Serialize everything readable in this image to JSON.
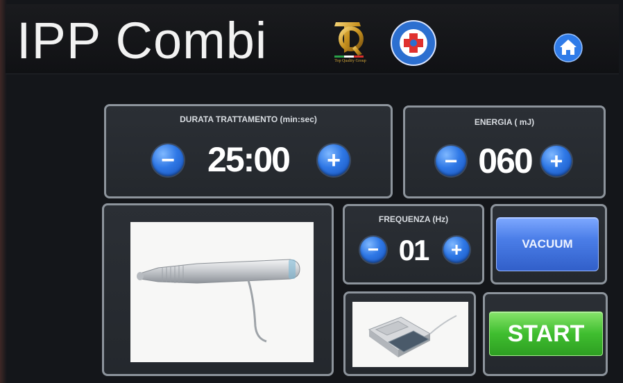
{
  "header": {
    "title": "IPP Combi",
    "logo_gold_caption": "Top Quality Group",
    "logo_medical_text": "MEDICAL BODY POINT"
  },
  "durata": {
    "label": "DURATA TRATTAMENTO (min:sec)",
    "value": "25:00"
  },
  "energia": {
    "label": "ENERGIA ( mJ)",
    "value": "060"
  },
  "frequenza": {
    "label": "FREQUENZA (Hz)",
    "value": "01"
  },
  "buttons": {
    "minus_symbol": "−",
    "plus_symbol": "+",
    "vacuum_label": "VACUUM",
    "start_label": "START"
  },
  "icons": {
    "home": "home-icon",
    "handpiece": "handpiece-image",
    "footswitch": "footswitch-image"
  },
  "colors": {
    "accent_blue": "#2f78e6",
    "start_green": "#3fbe2f",
    "panel_border": "#8d949c",
    "background": "#14161a"
  }
}
